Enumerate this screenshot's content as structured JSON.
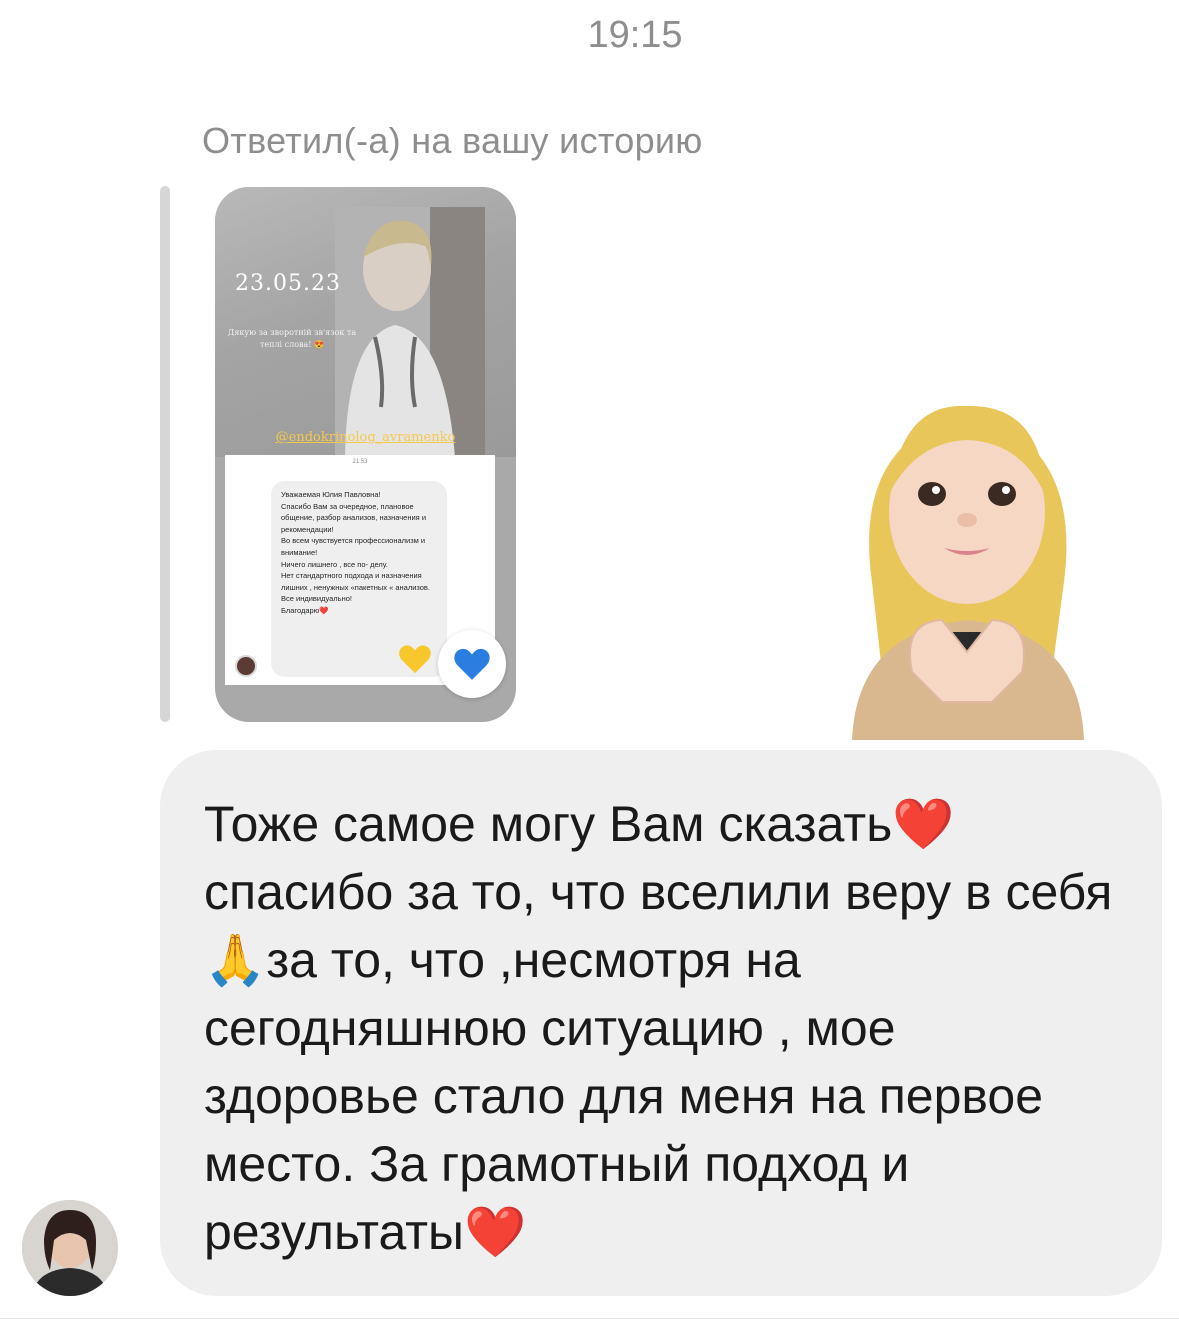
{
  "header": {
    "timestamp": "19:15"
  },
  "reply": {
    "label": "Ответил(-а) на вашу историю"
  },
  "story": {
    "date": "23.05.23",
    "caption": "Дякую за зворотній зв'язок та теплі слова! 😍",
    "mention": "@endokrinolog_avramenko",
    "screenshot": {
      "time": "21:53",
      "text": "Уважаемая Юлия Павловна!\nСпасибо Вам за очередное, плановое общение, разбор анализов, назначения и рекомендации!\nВо всем чувствуется профессионализм и внимание!\nНичего лишнего , все по- делу.\nНет стандартного подхода и назначения лишних , ненужных «пакетных « анализов. Все индивидуально!\nБлагодарю❤️"
    }
  },
  "reaction": {
    "icon": "blue-heart-icon",
    "color": "#2b7de0"
  },
  "message": {
    "text": "Тоже самое могу Вам сказать❤️\nспасибо за то, что вселили веру в себя🙏за то, что ,несмотря на сегодняшнюю ситуацию , мое здоровье стало для меня на первое место. За грамотный подход и результаты❤️"
  },
  "colors": {
    "bubble": "#efefef",
    "muted_text": "#8e8e8e",
    "heart_red": "#e8232f",
    "mention_gold": "#f6c94b"
  }
}
